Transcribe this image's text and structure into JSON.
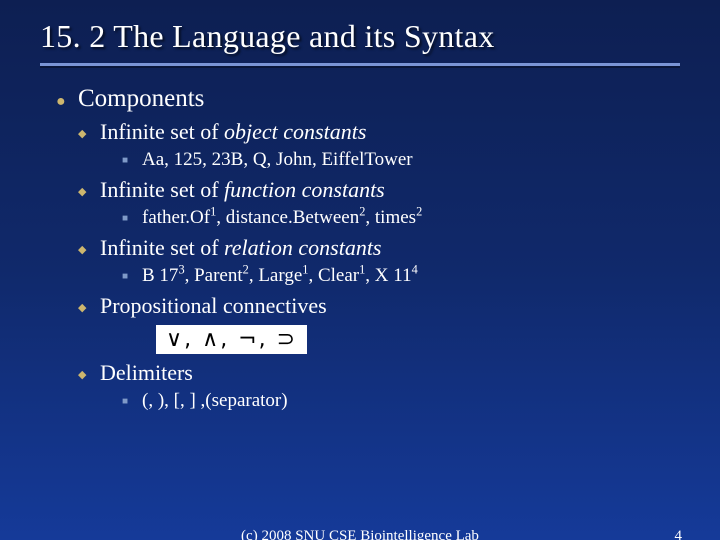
{
  "title": "15. 2 The Language and its Syntax",
  "lvl1": {
    "label": "Components"
  },
  "sub": {
    "a": {
      "prefix": "Infinite set of ",
      "em": "object constants",
      "ex": "Aa, 125, 23B, Q, John, EiffelTower"
    },
    "b": {
      "prefix": "Infinite set of ",
      "em": "function constants",
      "ex_parts": {
        "p1": "father.Of",
        "s1": "1",
        "p2": ", distance.Between",
        "s2": "2",
        "p3": ", times",
        "s3": "2"
      }
    },
    "c": {
      "prefix": "Infinite set of ",
      "em": "relation constants",
      "ex_parts": {
        "p1": "B 17",
        "s1": "3",
        "p2": ", Parent",
        "s2": "2",
        "p3": ", Large",
        "s3": "1",
        "p4": ", Clear",
        "s4": "1",
        "p5": ", X 11",
        "s5": "4"
      }
    },
    "d": {
      "label": "Propositional connectives",
      "symbols": "∨,  ∧,  ¬,  ⊃"
    },
    "e": {
      "label": "Delimiters",
      "ex": "(, ), [, ] ,(separator)"
    }
  },
  "footer": {
    "center": "(c) 2008 SNU CSE Biointelligence Lab",
    "page": "4"
  }
}
